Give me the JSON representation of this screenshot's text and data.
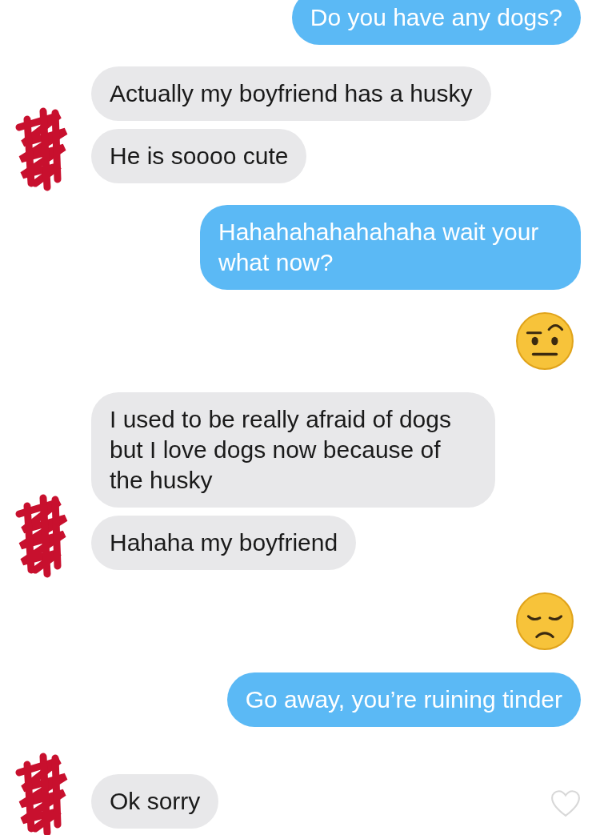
{
  "messages": [
    {
      "kind": "outgoing",
      "lines": [
        "Do you have any dogs?"
      ]
    },
    {
      "kind": "incoming",
      "bubbles": [
        {
          "text": "Actually my boyfriend has a husky"
        },
        {
          "text": "He is soooo cute"
        }
      ]
    },
    {
      "kind": "outgoing",
      "lines": [
        "Hahahahahahahaha wait your what now?"
      ]
    },
    {
      "kind": "skeptical"
    },
    {
      "kind": "incoming",
      "bubbles": [
        {
          "text": "I used to be really afraid of dogs but I love dogs now because of the husky"
        },
        {
          "text": "Hahaha my boyfriend"
        }
      ]
    },
    {
      "kind": "sad"
    },
    {
      "kind": "outgoing",
      "lines": [
        "Go away, you’re ruining tinder"
      ]
    },
    {
      "kind": "incoming",
      "bubbles": [
        {
          "text": "Ok sorry"
        }
      ],
      "liked": false
    }
  ]
}
